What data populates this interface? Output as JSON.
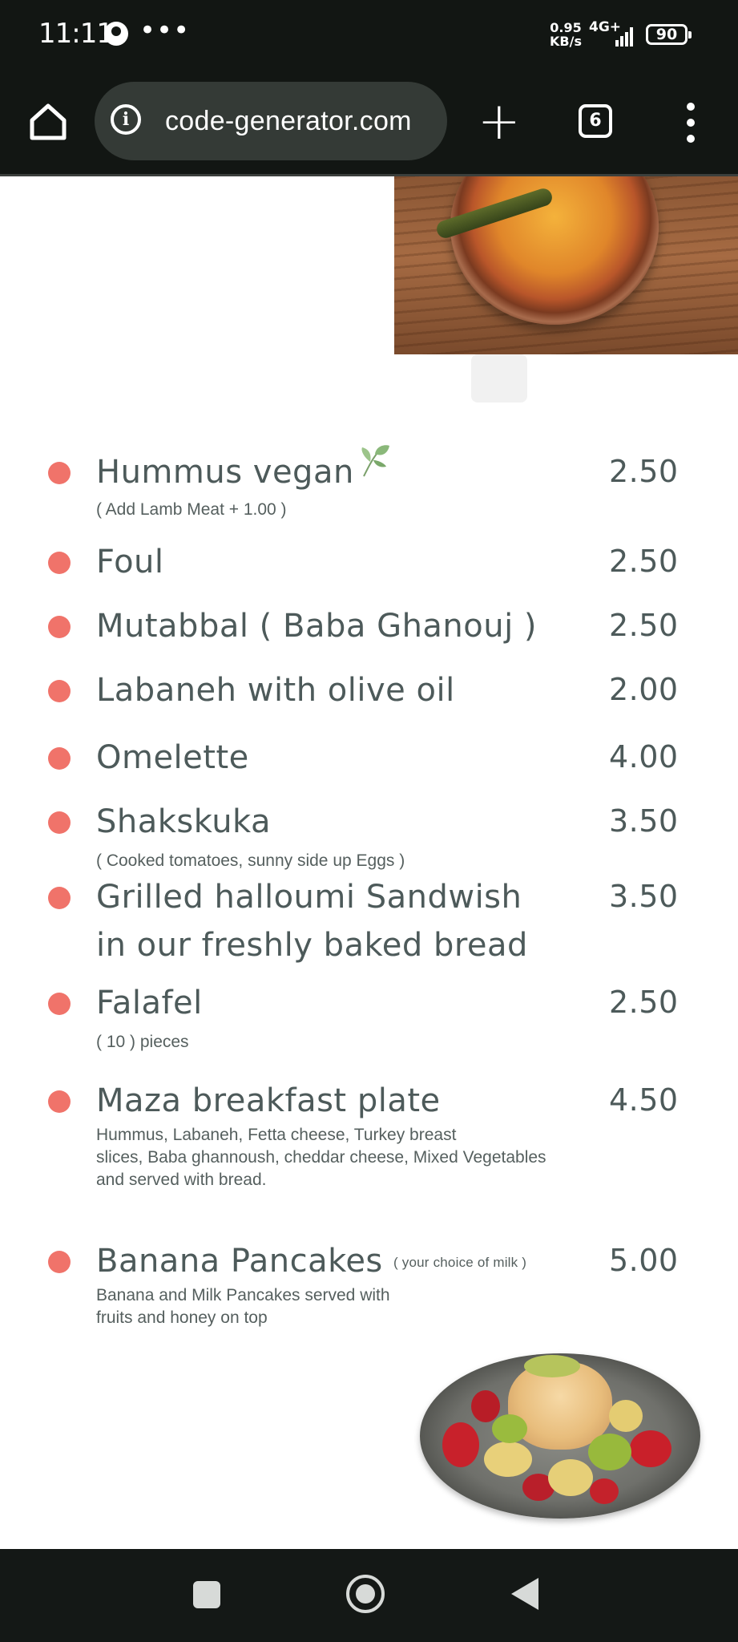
{
  "status_bar": {
    "time": "11:11",
    "more_indicator": "•••",
    "data_speed_value": "0.95",
    "data_speed_unit": "KB/s",
    "network_type": "4G+",
    "battery_level": "90"
  },
  "browser": {
    "url": "code-generator.com",
    "tab_count": "6"
  },
  "menu": {
    "items": [
      {
        "name": "Hummus vegan",
        "note": "( Add Lamb Meat + 1.00 )",
        "price": "2.50"
      },
      {
        "name": "Foul",
        "price": "2.50"
      },
      {
        "name": "Mutabbal ( Baba Ghanouj )",
        "price": "2.50"
      },
      {
        "name": "Labaneh with olive oil",
        "price": "2.00"
      },
      {
        "name": "Omelette",
        "price": "4.00"
      },
      {
        "name": "Shakskuka",
        "note": "( Cooked tomatoes, sunny side up Eggs )",
        "price": "3.50"
      },
      {
        "name_line1": "Grilled halloumi Sandwish",
        "name_line2": "in our freshly baked bread",
        "price": "3.50"
      },
      {
        "name": "Falafel",
        "note": "( 10 ) pieces",
        "price": "2.50"
      },
      {
        "name": "Maza breakfast plate",
        "description_lines": [
          "Hummus, Labaneh, Fetta cheese, Turkey breast",
          "slices, Baba ghannoush, cheddar cheese, Mixed Vegetables",
          "and served with bread."
        ],
        "price": "4.50"
      },
      {
        "name": "Banana Pancakes",
        "inline_note": "( your choice of milk )",
        "description_lines": [
          "Banana and Milk Pancakes served with",
          "fruits and honey on top"
        ],
        "price": "5.00"
      }
    ]
  },
  "icons": {
    "home": "home-icon",
    "info": "info-icon",
    "new_tab": "plus-icon",
    "tabs": "tab-switcher-icon",
    "menu": "more-vert-icon",
    "vegan": "leaf-icon"
  },
  "colors": {
    "bullet": "#f0736a",
    "item_text": "#4d5a5a",
    "chrome_bg": "#121613"
  }
}
